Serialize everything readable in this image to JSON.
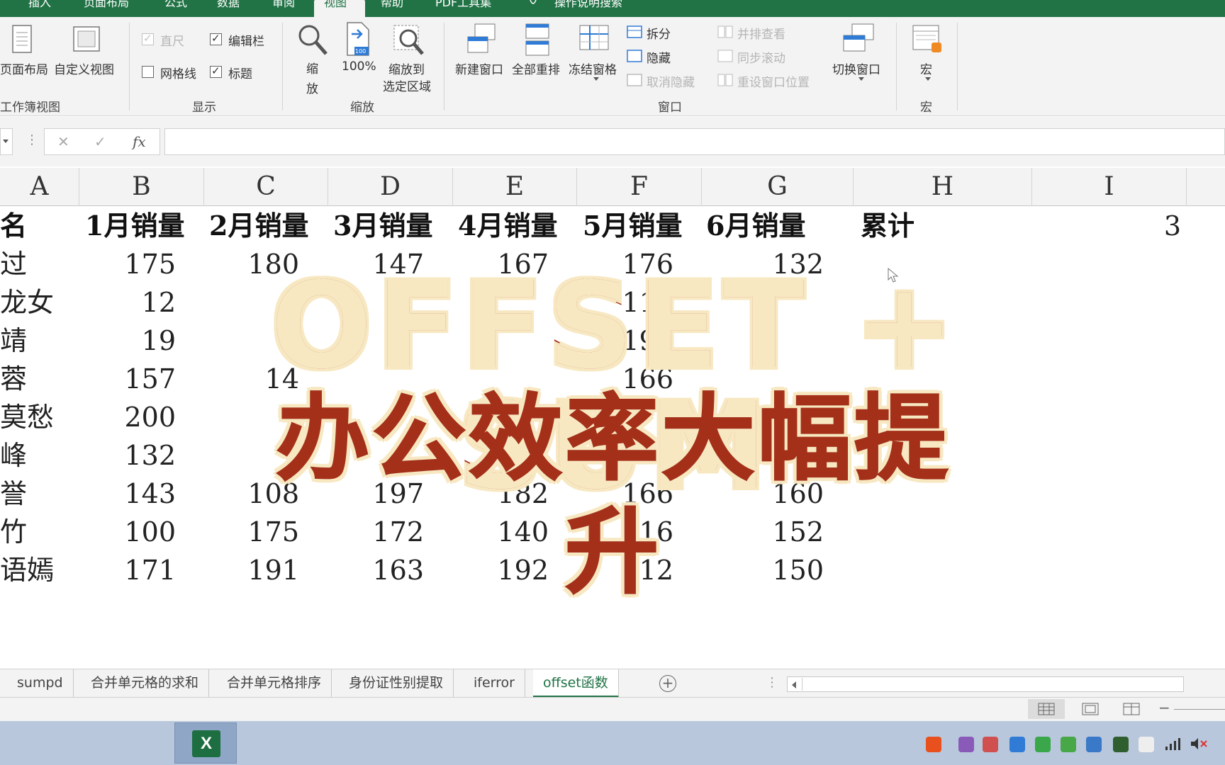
{
  "ribbon": {
    "tabs": [
      "插入",
      "页面布局",
      "公式",
      "数据",
      "审阅",
      "视图",
      "帮助",
      "PDF工具集",
      "操作说明搜索"
    ],
    "active_tab": "视图",
    "workbook_views": {
      "page_layout": "页面布局",
      "custom_views": "自定义视图",
      "group_label": "工作簿视图"
    },
    "show": {
      "ruler": "直尺",
      "formula_bar": "编辑栏",
      "gridlines": "网格线",
      "headings": "标题",
      "group_label": "显示",
      "ruler_checked": true,
      "formula_bar_checked": true,
      "gridlines_checked": false,
      "headings_checked": true
    },
    "zoom": {
      "zoom": "缩放",
      "zoom_100": "100%",
      "zoom_selection_1": "缩放到",
      "zoom_selection_2": "选定区域",
      "group_label": "缩放",
      "icon_label": "100"
    },
    "window": {
      "new_window": "新建窗口",
      "arrange_all": "全部重排",
      "freeze_panes": "冻结窗格",
      "split": "拆分",
      "hide": "隐藏",
      "unhide": "取消隐藏",
      "view_side_by_side": "并排查看",
      "sync_scroll": "同步滚动",
      "reset_position": "重设窗口位置",
      "switch_windows": "切换窗口",
      "group_label": "窗口"
    },
    "macros": {
      "macros": "宏",
      "group_label": "宏"
    }
  },
  "formula_bar": {
    "cancel": "✕",
    "enter": "✓",
    "fx": "fx",
    "content": ""
  },
  "columns": [
    "A",
    "B",
    "C",
    "D",
    "E",
    "F",
    "G",
    "H",
    "I"
  ],
  "sheet": {
    "header": [
      "名",
      "1月销量",
      "2月销量",
      "3月销量",
      "4月销量",
      "5月销量",
      "6月销量",
      "累计"
    ],
    "i1_value": "3",
    "rows": [
      {
        "name": "过",
        "values": [
          "175",
          "180",
          "147",
          "167",
          "176",
          "132"
        ]
      },
      {
        "name": "龙女",
        "values": [
          "12",
          "",
          "",
          "",
          "118",
          ""
        ]
      },
      {
        "name": "靖",
        "values": [
          "19",
          "",
          "",
          "",
          "190",
          ""
        ]
      },
      {
        "name": "蓉",
        "values": [
          "157",
          "14",
          "",
          "",
          "166",
          ""
        ]
      },
      {
        "name": "莫愁",
        "values": [
          "200",
          "",
          "",
          "",
          "",
          ""
        ]
      },
      {
        "name": "峰",
        "values": [
          "132",
          "",
          "",
          "",
          "",
          ""
        ]
      },
      {
        "name": "誉",
        "values": [
          "143",
          "108",
          "197",
          "182",
          "166",
          "160"
        ]
      },
      {
        "name": "竹",
        "values": [
          "100",
          "175",
          "172",
          "140",
          "116",
          "152"
        ]
      },
      {
        "name": "语嫣",
        "values": [
          "171",
          "191",
          "163",
          "192",
          "112",
          "150"
        ]
      }
    ]
  },
  "overlay": {
    "title": "OFFSET + SUM",
    "subtitle": "办公效率大幅提升"
  },
  "sheet_tabs": [
    "sumpd",
    "合并单元格的求和",
    "合并单元格排序",
    "身份证性别提取",
    "iferror",
    "offset函数"
  ],
  "active_sheet": "offset函数",
  "colors": {
    "excel_green": "#217346",
    "overlay_red": "#a4301a",
    "overlay_cream": "#f7e8c2"
  }
}
